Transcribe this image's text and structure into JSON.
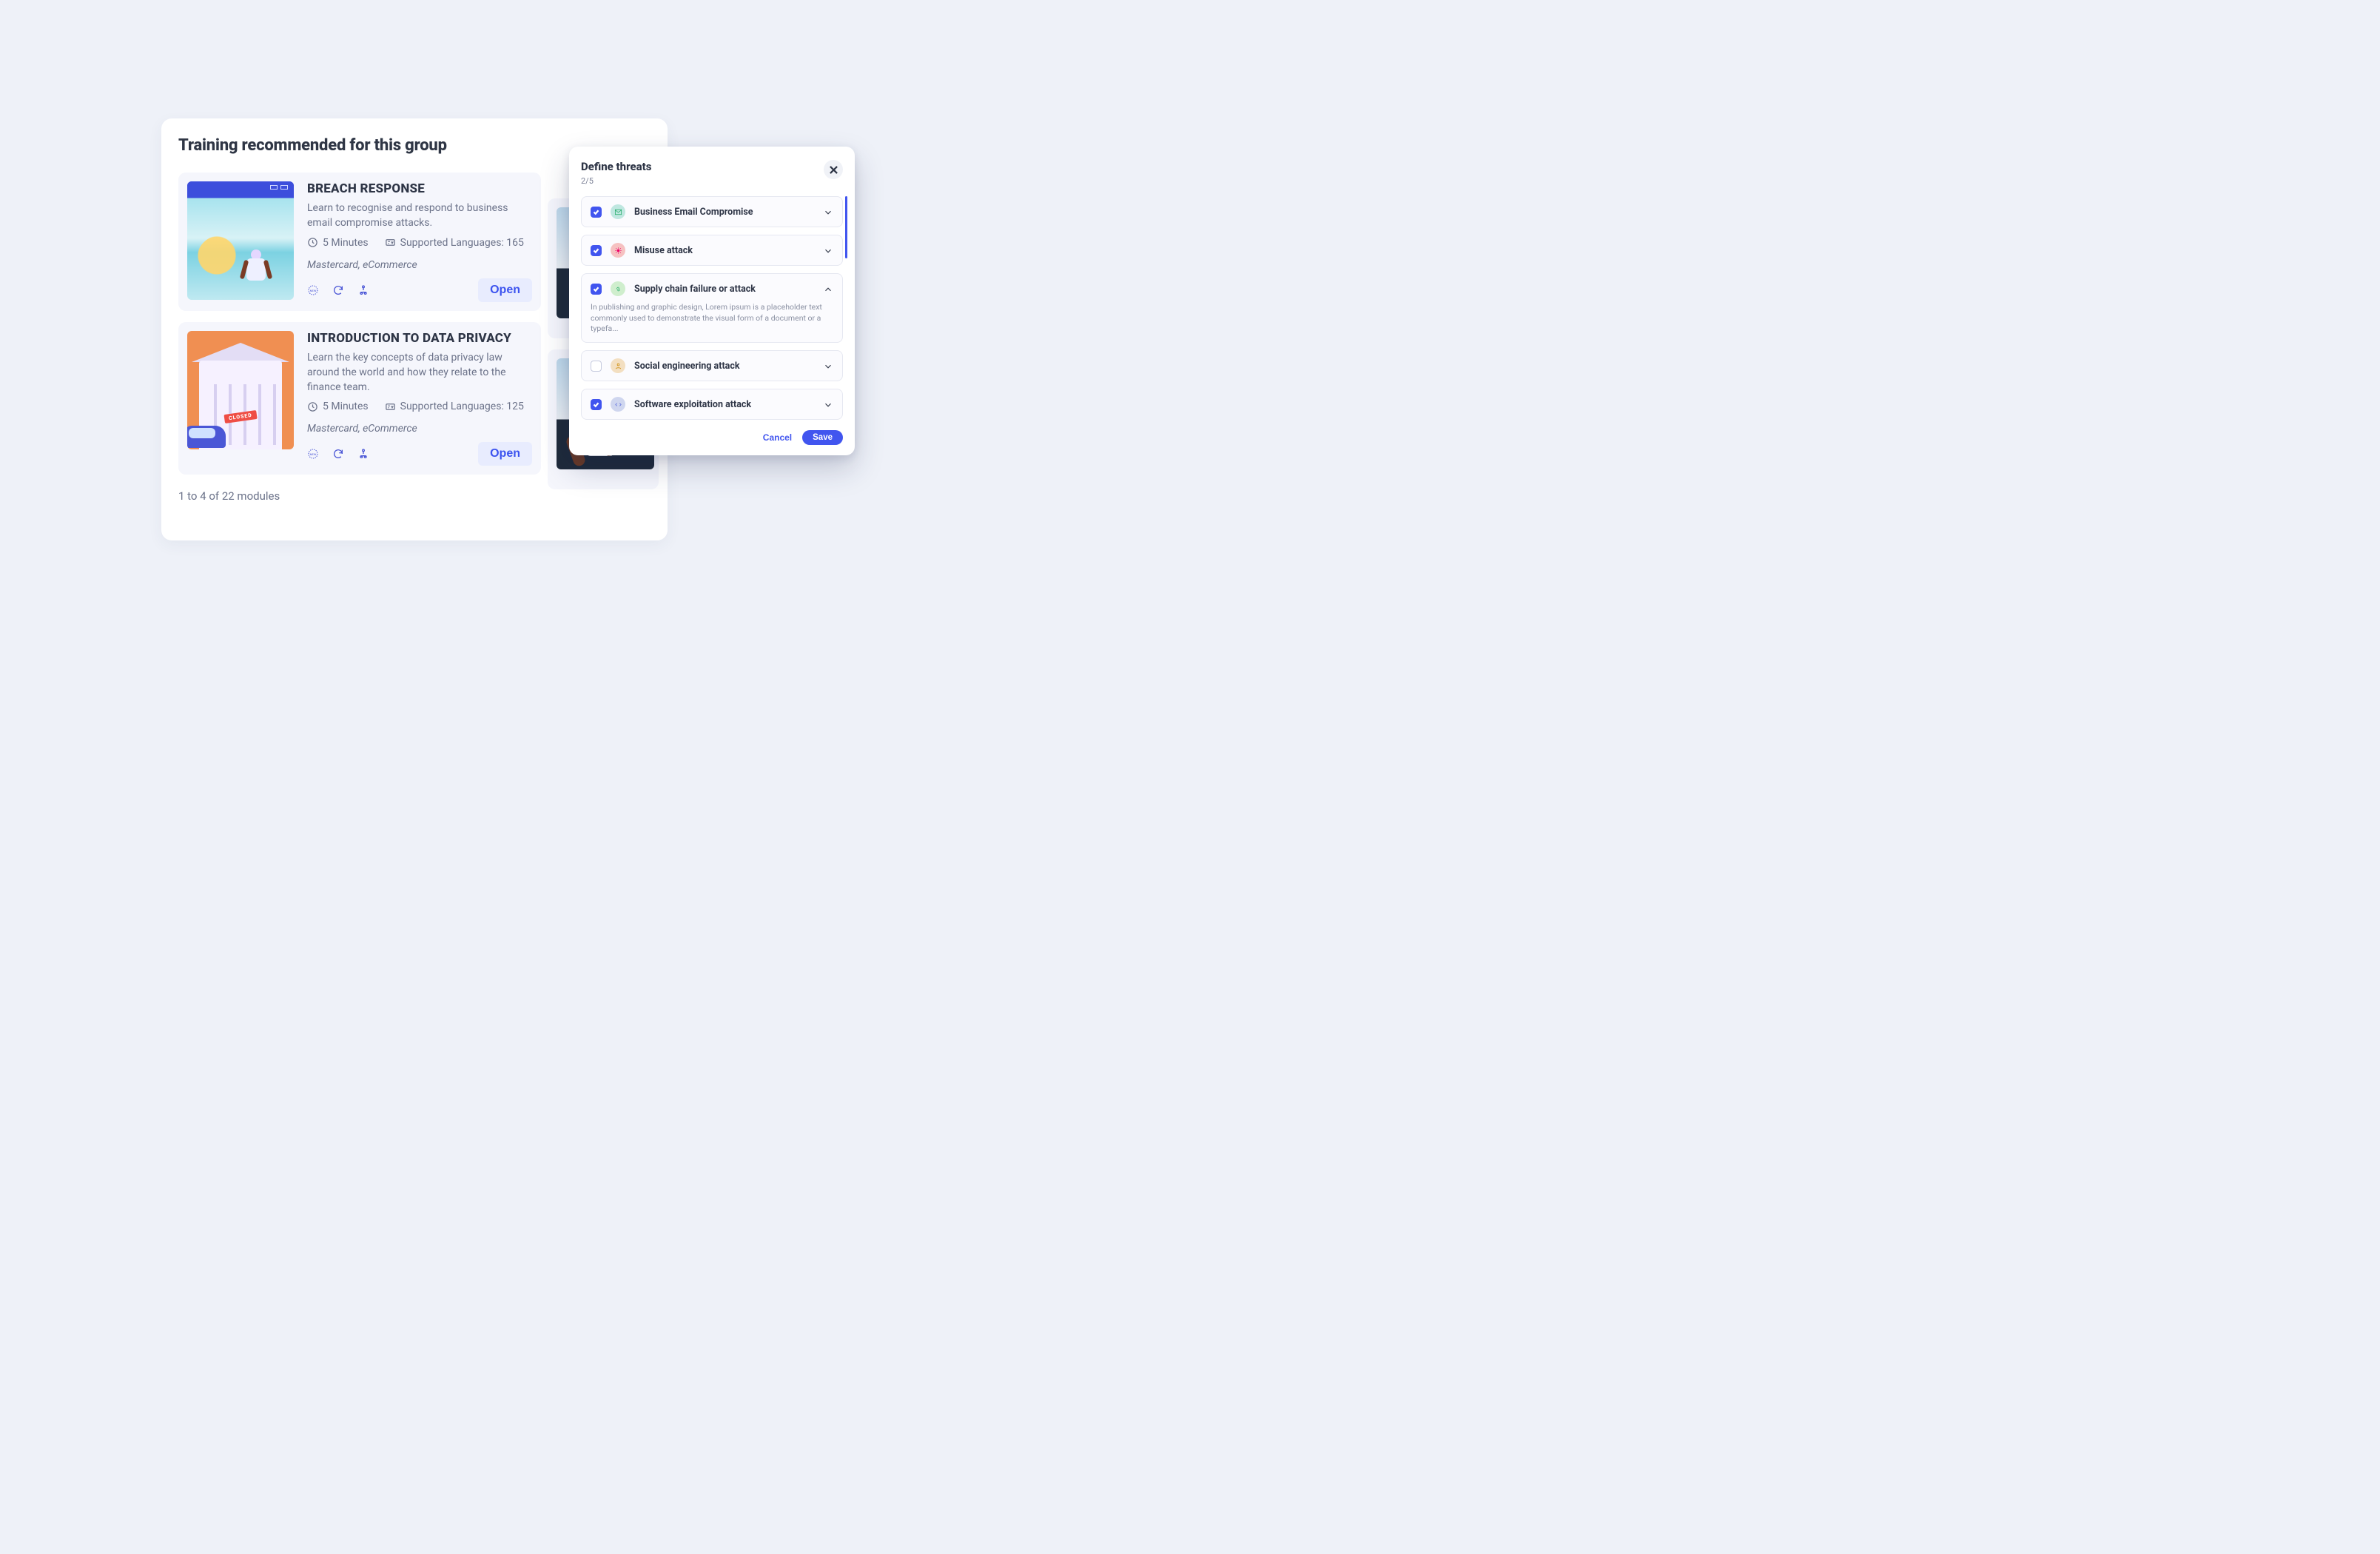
{
  "training": {
    "header": "Training recommended for this group",
    "cards": [
      {
        "title": "BREACH RESPONSE",
        "desc": " Learn to recognise and respond to business email compromise attacks.",
        "duration": "5 Minutes",
        "languages": "Supported Languages: 165",
        "tags": "Mastercard, eCommerce",
        "open": "Open"
      },
      {
        "title": "INTRODUCTION TO DATA PRIVACY",
        "desc": "Learn the key concepts of data privacy law around the world and how they relate to the finance team.",
        "duration": "5 Minutes",
        "languages": "Supported Languages: 125",
        "tags": "Mastercard, eCommerce",
        "open": "Open"
      }
    ],
    "pager": "1 to 4 of 22 modules",
    "closed_sign": "CLOSED"
  },
  "modal": {
    "title": "Define threats",
    "step": "2/5",
    "threats": [
      {
        "name": "Business Email Compromise",
        "checked": true,
        "color": "#bfe7e0",
        "expanded": false
      },
      {
        "name": "Misuse attack",
        "checked": true,
        "color": "#f6c1c1",
        "expanded": false
      },
      {
        "name": "Supply chain failure or attack",
        "checked": true,
        "color": "#cfeecd",
        "expanded": true,
        "desc": "In publishing and graphic design, Lorem ipsum is a placeholder text commonly used to demonstrate the visual form of a document or a typefa..."
      },
      {
        "name": "Social engineering attack",
        "checked": false,
        "color": "#f3dfc1",
        "expanded": false
      },
      {
        "name": "Software exploitation attack",
        "checked": true,
        "color": "#cfd6ef",
        "expanded": false
      }
    ],
    "cancel": "Cancel",
    "save": "Save"
  }
}
